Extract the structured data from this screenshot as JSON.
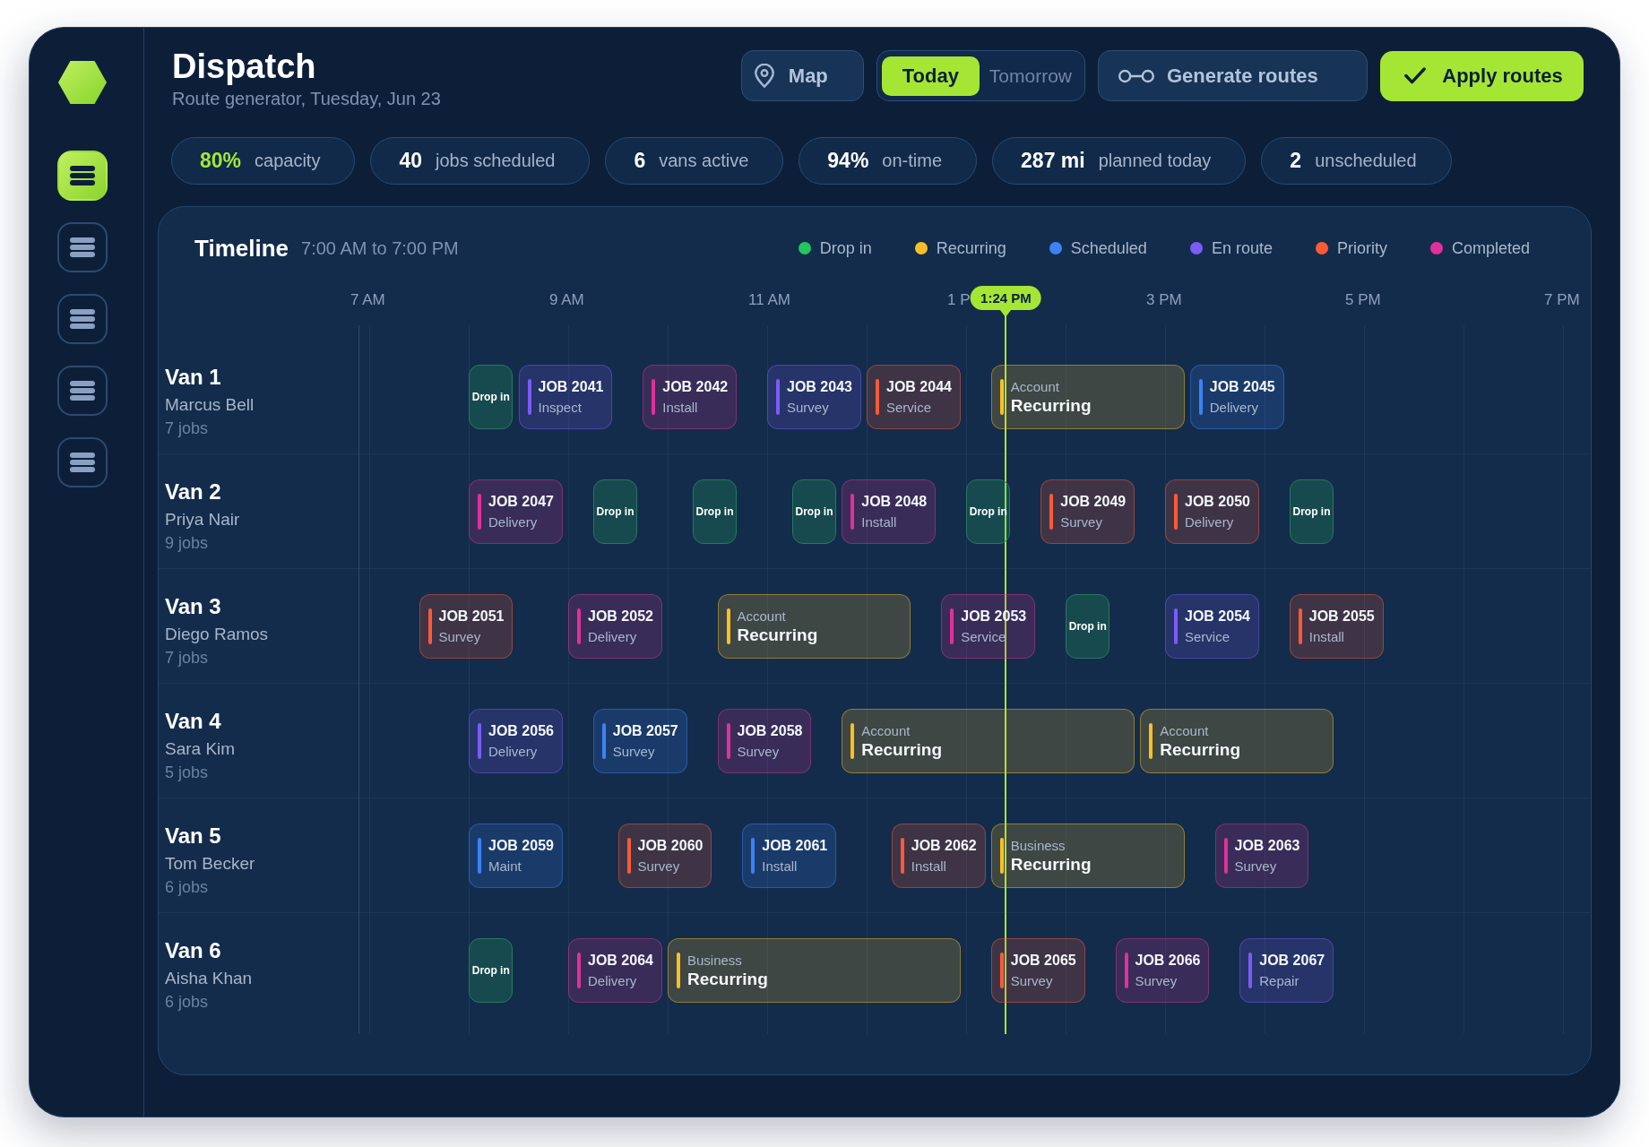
{
  "sidebar": {
    "items": [
      {
        "selected": true
      },
      {
        "selected": false
      },
      {
        "selected": false
      },
      {
        "selected": false
      },
      {
        "selected": false
      }
    ]
  },
  "header": {
    "title": "Dispatch",
    "subtitle": "Route generator, Tuesday, Jun 23"
  },
  "toolbar": {
    "map_button": "Map",
    "day_tabs": [
      {
        "label": "Today",
        "selected": true
      },
      {
        "label": "Tomorrow",
        "selected": false
      }
    ],
    "generate_button": "Generate routes",
    "apply_button": "Apply routes"
  },
  "stats": [
    {
      "value": "80%",
      "label": "capacity",
      "highlight": true
    },
    {
      "value": "40",
      "label": "jobs scheduled",
      "highlight": false
    },
    {
      "value": "6",
      "label": "vans active",
      "highlight": false
    },
    {
      "value": "94%",
      "label": "on-time",
      "highlight": false
    },
    {
      "value": "287 mi",
      "label": "planned today",
      "highlight": false
    },
    {
      "value": "2",
      "label": "unscheduled",
      "highlight": false
    }
  ],
  "timeline": {
    "title": "Timeline",
    "range": "7:00 AM to 7:00 PM",
    "legend": [
      {
        "label": "Drop in",
        "color": "#22c55e"
      },
      {
        "label": "Recurring",
        "color": "#fbbf24"
      },
      {
        "label": "Scheduled",
        "color": "#3b82f6"
      },
      {
        "label": "En route",
        "color": "#7c5cf6"
      },
      {
        "label": "Priority",
        "color": "#ff5a36"
      },
      {
        "label": "Completed",
        "color": "#e0319a"
      }
    ],
    "ticks": [
      "7 AM",
      "9 AM",
      "11 AM",
      "1 P",
      "3 PM",
      "5 PM",
      "7 PM"
    ],
    "now_label": "1:24 PM",
    "vans": [
      {
        "name": "Van 1",
        "driver": "Marcus Bell",
        "job_count": "7 jobs",
        "jobs": [
          {
            "kind": "drop_in",
            "title": "Drop in"
          },
          {
            "kind": "job",
            "title": "JOB 2041",
            "service": "Inspect",
            "color": "#7c5cf6"
          },
          {
            "kind": "job",
            "title": "JOB 2042",
            "service": "Install",
            "color": "#e0319a"
          },
          {
            "kind": "job",
            "title": "JOB 2043",
            "service": "Survey",
            "color": "#7c5cf6"
          },
          {
            "kind": "job",
            "title": "JOB 2044",
            "service": "Service",
            "color": "#ff5a36"
          },
          {
            "kind": "recurring",
            "category": "Account",
            "title": "Recurring",
            "color": "#fbbf24"
          },
          {
            "kind": "job",
            "title": "JOB 2045",
            "service": "Delivery",
            "color": "#3b82f6"
          }
        ]
      },
      {
        "name": "Van 2",
        "driver": "Priya Nair",
        "job_count": "9 jobs",
        "jobs": [
          {
            "kind": "job",
            "title": "JOB 2047",
            "service": "Delivery",
            "color": "#e0319a"
          },
          {
            "kind": "drop_in",
            "title": "Drop in"
          },
          {
            "kind": "drop_in",
            "title": "Drop in"
          },
          {
            "kind": "drop_in",
            "title": "Drop in"
          },
          {
            "kind": "job",
            "title": "JOB 2048",
            "service": "Install",
            "color": "#e0319a"
          },
          {
            "kind": "drop_in",
            "title": "Drop in"
          },
          {
            "kind": "job",
            "title": "JOB 2049",
            "service": "Survey",
            "color": "#ff5a36"
          },
          {
            "kind": "job",
            "title": "JOB 2050",
            "service": "Delivery",
            "color": "#ff5a36"
          },
          {
            "kind": "drop_in",
            "title": "Drop in"
          }
        ]
      },
      {
        "name": "Van 3",
        "driver": "Diego Ramos",
        "job_count": "7 jobs",
        "jobs": [
          {
            "kind": "job",
            "title": "JOB 2051",
            "service": "Survey",
            "color": "#ff5a36"
          },
          {
            "kind": "job",
            "title": "JOB 2052",
            "service": "Delivery",
            "color": "#e0319a"
          },
          {
            "kind": "recurring",
            "category": "Account",
            "title": "Recurring",
            "color": "#fbbf24"
          },
          {
            "kind": "job",
            "title": "JOB 2053",
            "service": "Service",
            "color": "#e0319a"
          },
          {
            "kind": "drop_in",
            "title": "Drop in"
          },
          {
            "kind": "job",
            "title": "JOB 2054",
            "service": "Service",
            "color": "#7c5cf6"
          },
          {
            "kind": "job",
            "title": "JOB 2055",
            "service": "Install",
            "color": "#ff5a36"
          }
        ]
      },
      {
        "name": "Van 4",
        "driver": "Sara Kim",
        "job_count": "5 jobs",
        "jobs": [
          {
            "kind": "job",
            "title": "JOB 2056",
            "service": "Delivery",
            "color": "#7c5cf6"
          },
          {
            "kind": "job",
            "title": "JOB 2057",
            "service": "Survey",
            "color": "#3b82f6"
          },
          {
            "kind": "job",
            "title": "JOB 2058",
            "service": "Survey",
            "color": "#e0319a"
          },
          {
            "kind": "recurring",
            "category": "Account",
            "title": "Recurring",
            "color": "#fbbf24"
          },
          {
            "kind": "recurring",
            "category": "Account",
            "title": "Recurring",
            "color": "#fbbf24"
          }
        ]
      },
      {
        "name": "Van 5",
        "driver": "Tom Becker",
        "job_count": "6 jobs",
        "jobs": [
          {
            "kind": "job",
            "title": "JOB 2059",
            "service": "Maint",
            "color": "#3b82f6"
          },
          {
            "kind": "job",
            "title": "JOB 2060",
            "service": "Survey",
            "color": "#ff5a36"
          },
          {
            "kind": "job",
            "title": "JOB 2061",
            "service": "Install",
            "color": "#3b82f6"
          },
          {
            "kind": "job",
            "title": "JOB 2062",
            "service": "Install",
            "color": "#ff5a36"
          },
          {
            "kind": "recurring",
            "category": "Business",
            "title": "Recurring",
            "color": "#fbbf24"
          },
          {
            "kind": "job",
            "title": "JOB 2063",
            "service": "Survey",
            "color": "#e0319a"
          }
        ]
      },
      {
        "name": "Van 6",
        "driver": "Aisha Khan",
        "job_count": "6 jobs",
        "jobs": [
          {
            "kind": "drop_in",
            "title": "Drop in"
          },
          {
            "kind": "job",
            "title": "JOB 2064",
            "service": "Delivery",
            "color": "#e0319a"
          },
          {
            "kind": "recurring",
            "category": "Business",
            "title": "Recurring",
            "color": "#fbbf24"
          },
          {
            "kind": "job",
            "title": "JOB 2065",
            "service": "Survey",
            "color": "#ff5a36"
          },
          {
            "kind": "job",
            "title": "JOB 2066",
            "service": "Survey",
            "color": "#e0319a"
          },
          {
            "kind": "job",
            "title": "JOB 2067",
            "service": "Repair",
            "color": "#7c5cf6"
          }
        ]
      }
    ]
  }
}
